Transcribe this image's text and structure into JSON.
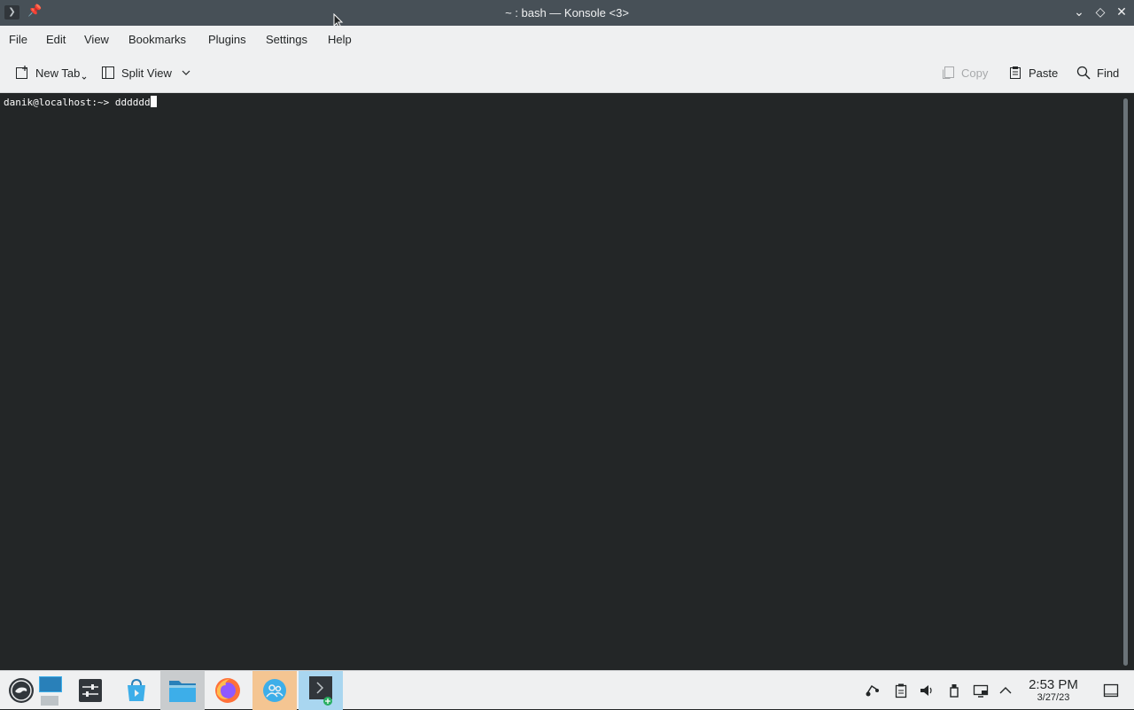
{
  "window": {
    "title": "~ : bash — Konsole <3>",
    "app_icon": "terminal-icon",
    "pin_icon": "pin-icon",
    "controls": {
      "minimize": "⌄",
      "maximize": "◇",
      "close": "✕"
    }
  },
  "menubar": {
    "items": [
      "File",
      "Edit",
      "View",
      "Bookmarks",
      "Plugins",
      "Settings",
      "Help"
    ]
  },
  "toolbar": {
    "new_tab": "New Tab",
    "split_view": "Split View",
    "copy": "Copy",
    "paste": "Paste",
    "find": "Find"
  },
  "terminal": {
    "prompt": "danik@localhost:~> ",
    "input": "dddddd"
  },
  "taskbar": {
    "apps": [
      "opensuse-menu-icon",
      "desktop-icon",
      "settings-icon",
      "discover-icon",
      "files-icon",
      "firefox-icon",
      "people-icon",
      "konsole-icon"
    ],
    "clock": {
      "time": "2:53 PM",
      "date": "3/27/23"
    }
  },
  "colors": {
    "titlebar": "#475057",
    "terminal_bg": "#232627",
    "chrome_bg": "#eff0f1",
    "accent": "#3daee9"
  }
}
